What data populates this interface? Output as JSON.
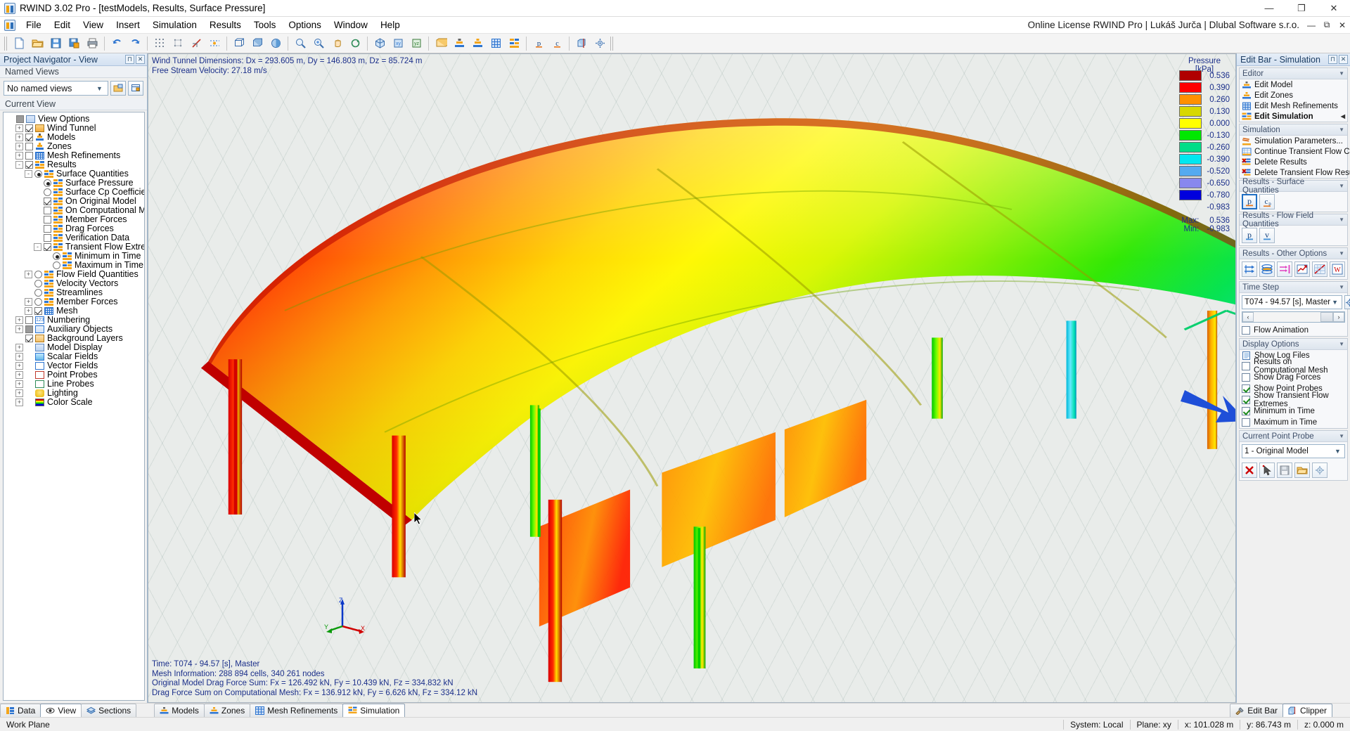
{
  "window": {
    "title": "RWIND 3.02 Pro - [testModels, Results, Surface Pressure]",
    "license": "Online License RWIND Pro | Lukáš Jurča | Dlubal Software s.r.o.",
    "minimize": "—",
    "maximize": "❐",
    "close": "✕"
  },
  "menu": {
    "items": [
      "File",
      "Edit",
      "View",
      "Insert",
      "Simulation",
      "Results",
      "Tools",
      "Options",
      "Window",
      "Help"
    ]
  },
  "left_panel": {
    "caption": "Project Navigator - View",
    "caption_pin": "⊓",
    "caption_close": "✕",
    "named_views_label": "Named Views",
    "named_views_value": "No named views",
    "current_view_label": "Current View",
    "tree": [
      {
        "label": "View Options",
        "depth": 0,
        "control": "checkbox-gray",
        "expander": "",
        "icon": "view-options-icon"
      },
      {
        "label": "Wind Tunnel",
        "depth": 1,
        "control": "checkbox-on",
        "expander": "+",
        "icon": "wind-tunnel-icon"
      },
      {
        "label": "Models",
        "depth": 1,
        "control": "checkbox-on",
        "expander": "+",
        "icon": "models-icon"
      },
      {
        "label": "Zones",
        "depth": 1,
        "control": "checkbox-off",
        "expander": "+",
        "icon": "zones-icon"
      },
      {
        "label": "Mesh Refinements",
        "depth": 1,
        "control": "checkbox-off",
        "expander": "+",
        "icon": "mesh-refinements-icon"
      },
      {
        "label": "Results",
        "depth": 1,
        "control": "checkbox-on",
        "expander": "-",
        "icon": "results-icon"
      },
      {
        "label": "Surface Quantities",
        "depth": 2,
        "control": "radio-on",
        "expander": "-",
        "icon": "results-icon"
      },
      {
        "label": "Surface Pressure",
        "depth": 3,
        "control": "radio-on",
        "expander": "",
        "icon": "results-icon"
      },
      {
        "label": "Surface Cp Coefficient",
        "depth": 3,
        "control": "radio-off",
        "expander": "",
        "icon": "results-icon"
      },
      {
        "label": "On Original Model",
        "depth": 3,
        "control": "checkbox-on",
        "expander": "",
        "icon": "results-icon"
      },
      {
        "label": "On Computational Mesh",
        "depth": 3,
        "control": "checkbox-off",
        "expander": "",
        "icon": "results-icon"
      },
      {
        "label": "Member Forces",
        "depth": 3,
        "control": "checkbox-off",
        "expander": "",
        "icon": "results-icon"
      },
      {
        "label": "Drag Forces",
        "depth": 3,
        "control": "checkbox-off",
        "expander": "",
        "icon": "results-icon"
      },
      {
        "label": "Verification Data",
        "depth": 3,
        "control": "checkbox-off",
        "expander": "",
        "icon": "results-icon"
      },
      {
        "label": "Transient Flow Extremes",
        "depth": 3,
        "control": "checkbox-on",
        "expander": "-",
        "icon": "results-icon"
      },
      {
        "label": "Minimum in Time",
        "depth": 4,
        "control": "radio-on",
        "expander": "",
        "icon": "results-icon"
      },
      {
        "label": "Maximum in Time",
        "depth": 4,
        "control": "radio-off",
        "expander": "",
        "icon": "results-icon"
      },
      {
        "label": "Flow Field Quantities",
        "depth": 2,
        "control": "radio-off",
        "expander": "+",
        "icon": "results-icon"
      },
      {
        "label": "Velocity Vectors",
        "depth": 2,
        "control": "radio-off",
        "expander": "",
        "icon": "results-icon"
      },
      {
        "label": "Streamlines",
        "depth": 2,
        "control": "radio-off",
        "expander": "",
        "icon": "results-icon"
      },
      {
        "label": "Member Forces",
        "depth": 2,
        "control": "radio-off",
        "expander": "+",
        "icon": "results-icon"
      },
      {
        "label": "Mesh",
        "depth": 2,
        "control": "checkbox-on",
        "expander": "+",
        "icon": "mesh-icon"
      },
      {
        "label": "Numbering",
        "depth": 1,
        "control": "checkbox-off",
        "expander": "+",
        "icon": "numbering-icon"
      },
      {
        "label": "Auxiliary Objects",
        "depth": 1,
        "control": "checkbox-gray",
        "expander": "+",
        "icon": "auxiliary-objects-icon"
      },
      {
        "label": "Background Layers",
        "depth": 1,
        "control": "checkbox-on",
        "expander": "",
        "icon": "background-layers-icon"
      },
      {
        "label": "Model Display",
        "depth": 1,
        "control": "none",
        "expander": "+",
        "icon": "model-display-icon"
      },
      {
        "label": "Scalar Fields",
        "depth": 1,
        "control": "none",
        "expander": "+",
        "icon": "scalar-fields-icon"
      },
      {
        "label": "Vector Fields",
        "depth": 1,
        "control": "none",
        "expander": "+",
        "icon": "vector-fields-icon"
      },
      {
        "label": "Point Probes",
        "depth": 1,
        "control": "none",
        "expander": "+",
        "icon": "point-probes-icon"
      },
      {
        "label": "Line Probes",
        "depth": 1,
        "control": "none",
        "expander": "+",
        "icon": "line-probes-icon"
      },
      {
        "label": "Lighting",
        "depth": 1,
        "control": "none",
        "expander": "+",
        "icon": "lighting-icon"
      },
      {
        "label": "Color Scale",
        "depth": 1,
        "control": "none",
        "expander": "+",
        "icon": "color-scale-icon"
      }
    ]
  },
  "viewport": {
    "top_info": "Wind Tunnel Dimensions: Dx = 293.605 m, Dy = 146.803 m, Dz = 85.724 m\nFree Stream Velocity: 27.18 m/s",
    "bottom_info": "Time: T074 - 94.57 [s], Master\nMesh Information: 288 894 cells, 340 261 nodes\nOriginal Model Drag Force Sum: Fx = 126.492 kN, Fy = 10.439 kN, Fz = 334.832 kN\nDrag Force Sum on Computational Mesh: Fx = 136.912 kN, Fy = 6.626 kN, Fz = 334.12 kN",
    "axis_x": "X",
    "axis_y": "Y",
    "axis_z": "Z"
  },
  "legend": {
    "title": "Pressure [kPa]",
    "entries": [
      {
        "color": "#b00000",
        "value": "0.536"
      },
      {
        "color": "#ff0000",
        "value": "0.390"
      },
      {
        "color": "#ff9000",
        "value": "0.260"
      },
      {
        "color": "#d8d800",
        "value": "0.130"
      },
      {
        "color": "#ffff00",
        "value": "0.000"
      },
      {
        "color": "#00e800",
        "value": "-0.130"
      },
      {
        "color": "#00dd88",
        "value": "-0.260"
      },
      {
        "color": "#00e8f0",
        "value": "-0.390"
      },
      {
        "color": "#55aaf0",
        "value": "-0.520"
      },
      {
        "color": "#8888ee",
        "value": "-0.650"
      },
      {
        "color": "#0000dd",
        "value": "-0.780"
      }
    ],
    "last_value": "-0.983",
    "max_label": "Max:",
    "max_value": "0.536",
    "min_label": "Min:",
    "min_value": "-0.983"
  },
  "right_panel": {
    "caption": "Edit Bar - Simulation",
    "caption_pin": "⊓",
    "caption_close": "✕",
    "groups": {
      "editor": {
        "title": "Editor",
        "items": [
          {
            "label": "Edit Model",
            "icon": "edit-model-icon",
            "selected": false
          },
          {
            "label": "Edit Zones",
            "icon": "edit-zones-icon",
            "selected": false
          },
          {
            "label": "Edit Mesh Refinements",
            "icon": "edit-mesh-refinements-icon",
            "selected": false
          },
          {
            "label": "Edit Simulation",
            "icon": "edit-simulation-icon",
            "selected": true
          }
        ]
      },
      "simulation": {
        "title": "Simulation",
        "items": [
          {
            "label": "Simulation Parameters...",
            "icon": "simulation-parameters-icon"
          },
          {
            "label": "Continue Transient Flow Calculat...",
            "icon": "continue-transient-flow-icon"
          },
          {
            "label": "Delete Results",
            "icon": "delete-results-icon"
          },
          {
            "label": "Delete Transient Flow Results...",
            "icon": "delete-transient-results-icon"
          }
        ]
      },
      "results_surface": {
        "title": "Results - Surface Quantities",
        "buttons": [
          {
            "label": "p",
            "name": "surface-pressure-button",
            "active": true,
            "bar": "#e8761a"
          },
          {
            "label": "cₚ",
            "name": "surface-cp-button",
            "active": false,
            "bar": "#e8761a"
          }
        ]
      },
      "results_flow": {
        "title": "Results - Flow Field Quantities",
        "buttons": [
          {
            "label": "p",
            "name": "flow-pressure-button",
            "active": false,
            "bar": "#3f8fd8"
          },
          {
            "label": "v",
            "name": "flow-velocity-button",
            "active": false,
            "bar": "#3f8fd8"
          }
        ]
      },
      "results_other": {
        "title": "Results - Other Options",
        "buttons": [
          {
            "name": "velocity-vectors-button"
          },
          {
            "name": "streamlines-button"
          },
          {
            "name": "flow-lines-button"
          },
          {
            "name": "graph-button"
          },
          {
            "name": "diagram-button"
          },
          {
            "name": "word-report-button"
          }
        ]
      },
      "time_step": {
        "title": "Time Step",
        "value": "T074 - 94.57 [s], Master",
        "settings_icon": "settings-icon",
        "scroll_left": "‹",
        "scroll_right": "›",
        "flow_animation_label": "Flow Animation",
        "flow_animation_checked": false
      },
      "display_options": {
        "title": "Display Options",
        "items": [
          {
            "label": "Show Log Files",
            "type": "icon",
            "icon": "log-file-icon"
          },
          {
            "label": "Results on Computational Mesh",
            "type": "checkbox",
            "checked": false
          },
          {
            "label": "Show Drag Forces",
            "type": "checkbox",
            "checked": false
          },
          {
            "label": "Show Point Probes",
            "type": "checkbox",
            "checked": true
          },
          {
            "label": "Show Transient Flow Extremes",
            "type": "checkbox",
            "checked": true
          },
          {
            "label": "Minimum in Time",
            "type": "checkbox",
            "checked": true
          },
          {
            "label": "Maximum in Time",
            "type": "checkbox",
            "checked": false
          }
        ]
      },
      "current_point_probe": {
        "title": "Current Point Probe",
        "value": "1 - Original Model",
        "buttons": [
          {
            "name": "delete-probe-button",
            "glyph": "✕"
          },
          {
            "name": "pick-probe-button",
            "glyph": ""
          },
          {
            "name": "save-probe-button",
            "glyph": ""
          },
          {
            "name": "export-probe-button",
            "glyph": ""
          },
          {
            "name": "probe-settings-button",
            "glyph": ""
          }
        ]
      }
    }
  },
  "bottom_tabs": {
    "left_tabs": [
      {
        "label": "Data",
        "icon": "data-icon",
        "active": false
      },
      {
        "label": "View",
        "icon": "view-icon",
        "active": true
      },
      {
        "label": "Sections",
        "icon": "sections-icon",
        "active": false
      }
    ],
    "center_tabs": [
      {
        "label": "Models",
        "icon": "models-icon",
        "active": false
      },
      {
        "label": "Zones",
        "icon": "zones-icon",
        "active": false
      },
      {
        "label": "Mesh Refinements",
        "icon": "mesh-refinements-icon",
        "active": false
      },
      {
        "label": "Simulation",
        "icon": "simulation-icon",
        "active": true
      }
    ],
    "right_tabs": [
      {
        "label": "Edit Bar",
        "icon": "edit-bar-icon",
        "active": false
      },
      {
        "label": "Clipper",
        "icon": "clipper-icon",
        "active": true
      }
    ]
  },
  "status_bar": {
    "work_plane": "Work Plane",
    "system": "System: Local",
    "plane": "Plane: xy",
    "x": "x:  101.028 m",
    "y": "y:  86.743 m",
    "z": "z:  0.000 m"
  },
  "colors": {
    "accent": "#1f6fc4",
    "arrow": "#1f4fd8",
    "info_text": "#1b2f8a"
  }
}
